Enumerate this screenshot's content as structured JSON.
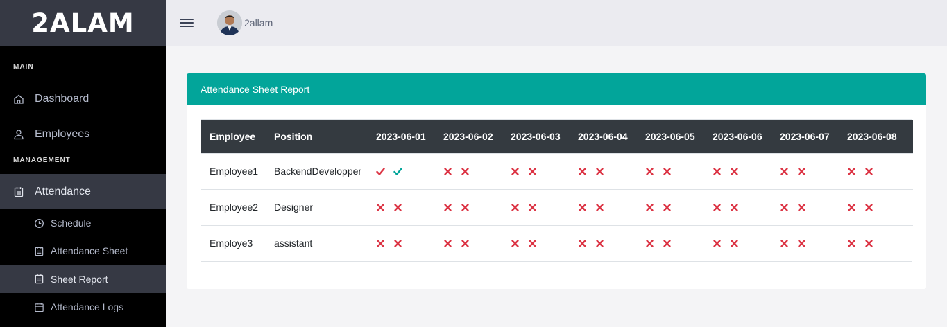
{
  "brand": {
    "name": "2ALAM"
  },
  "sidebar": {
    "sections": {
      "main": "MAIN",
      "management": "MANAGEMENT"
    },
    "items": [
      {
        "label": "Dashboard",
        "icon": "home-icon"
      },
      {
        "label": "Employees",
        "icon": "user-icon"
      },
      {
        "label": "Attendance",
        "icon": "clipboard-icon"
      }
    ],
    "subitems": [
      {
        "label": "Schedule",
        "icon": "clock-icon"
      },
      {
        "label": "Attendance Sheet",
        "icon": "clipboard-icon"
      },
      {
        "label": "Sheet Report",
        "icon": "clipboard-icon"
      },
      {
        "label": "Attendance Logs",
        "icon": "calendar-icon"
      }
    ]
  },
  "topbar": {
    "username": "2allam"
  },
  "card": {
    "title": "Attendance Sheet Report"
  },
  "table": {
    "columns": [
      "Employee",
      "Position",
      "2023-06-01",
      "2023-06-02",
      "2023-06-03",
      "2023-06-04",
      "2023-06-05",
      "2023-06-06",
      "2023-06-07",
      "2023-06-08"
    ],
    "rows": [
      {
        "employee": "Employee1",
        "position": "BackendDevelopper",
        "days": [
          [
            "check",
            "check"
          ],
          [
            "x",
            "x"
          ],
          [
            "x",
            "x"
          ],
          [
            "x",
            "x"
          ],
          [
            "x",
            "x"
          ],
          [
            "x",
            "x"
          ],
          [
            "x",
            "x"
          ],
          [
            "x",
            "x"
          ]
        ]
      },
      {
        "employee": "Employee2",
        "position": "Designer",
        "days": [
          [
            "x",
            "x"
          ],
          [
            "x",
            "x"
          ],
          [
            "x",
            "x"
          ],
          [
            "x",
            "x"
          ],
          [
            "x",
            "x"
          ],
          [
            "x",
            "x"
          ],
          [
            "x",
            "x"
          ],
          [
            "x",
            "x"
          ]
        ]
      },
      {
        "employee": "Employe3",
        "position": "assistant",
        "days": [
          [
            "x",
            "x"
          ],
          [
            "x",
            "x"
          ],
          [
            "x",
            "x"
          ],
          [
            "x",
            "x"
          ],
          [
            "x",
            "x"
          ],
          [
            "x",
            "x"
          ],
          [
            "x",
            "x"
          ],
          [
            "x",
            "x"
          ]
        ]
      }
    ]
  },
  "colors": {
    "accent": "#02a59a",
    "absent": "#dc3545",
    "present_first": "#dc3545",
    "present_second": "#02a59a",
    "sidebar_bg": "#000000",
    "sidebar_active": "#363944"
  }
}
